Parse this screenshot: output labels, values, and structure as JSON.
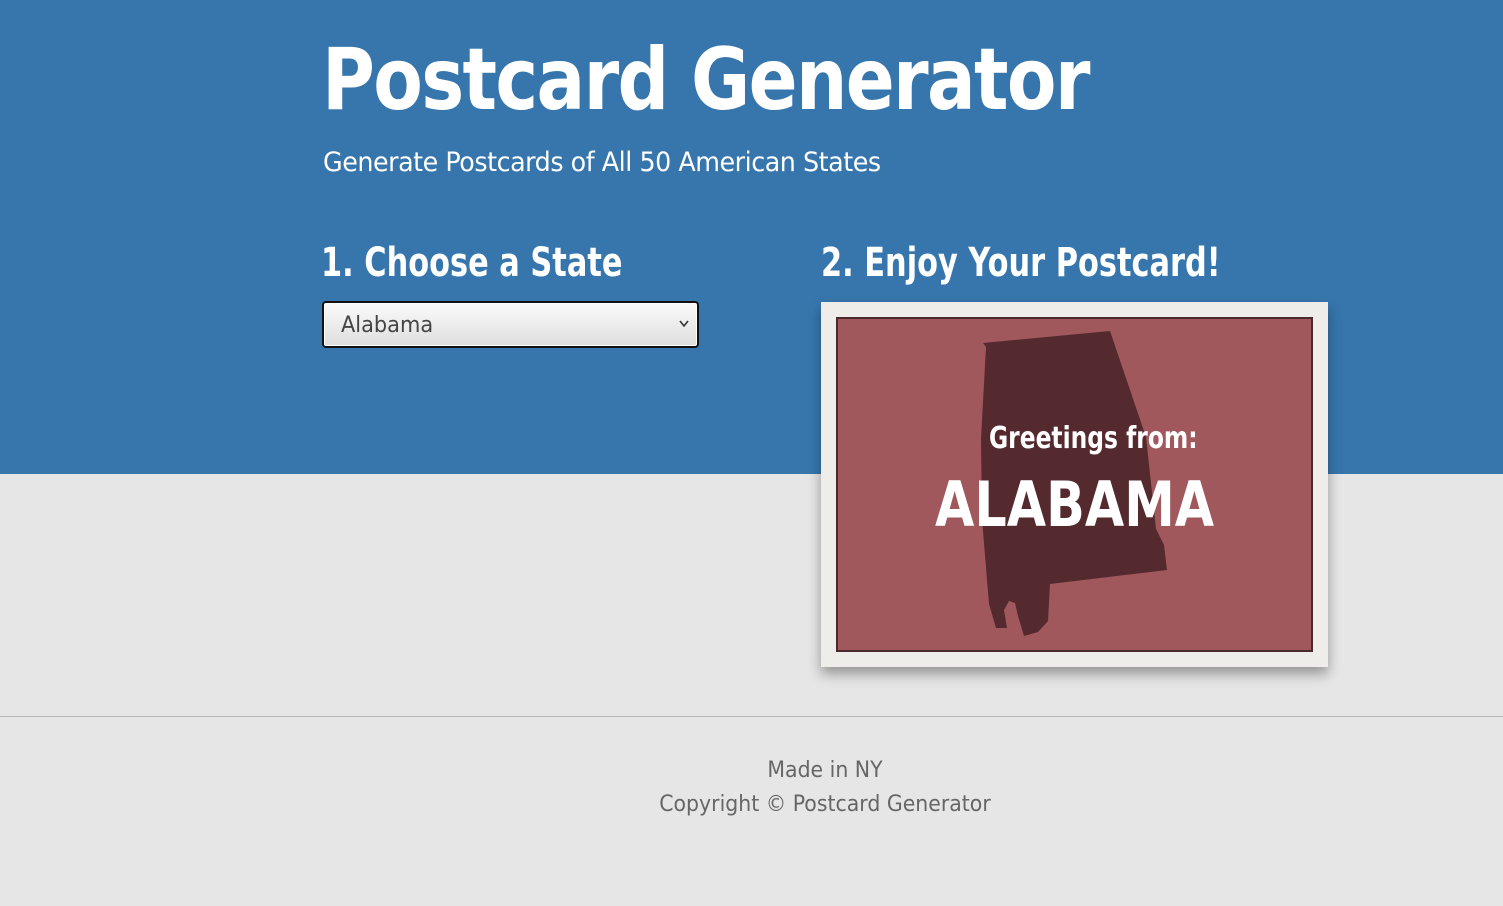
{
  "header": {
    "title": "Postcard Generator",
    "subtitle": "Generate Postcards of All 50 American States"
  },
  "steps": {
    "choose_heading": "1. Choose a State",
    "enjoy_heading": "2. Enjoy Your Postcard!"
  },
  "state_select": {
    "selected": "Alabama",
    "chevron_icon": "chevron-down-icon"
  },
  "postcard": {
    "greeting": "Greetings from:",
    "state_name": "ALABAMA",
    "shape_icon": "alabama-silhouette",
    "colors": {
      "frame": "#efedea",
      "background": "#a0585c",
      "silhouette": "#542a2f",
      "text": "#ffffff"
    }
  },
  "footer": {
    "made_in": "Made in NY",
    "copyright": "Copyright © Postcard Generator"
  },
  "theme": {
    "header_bg": "#3776ad",
    "page_bg": "#e6e6e6"
  }
}
